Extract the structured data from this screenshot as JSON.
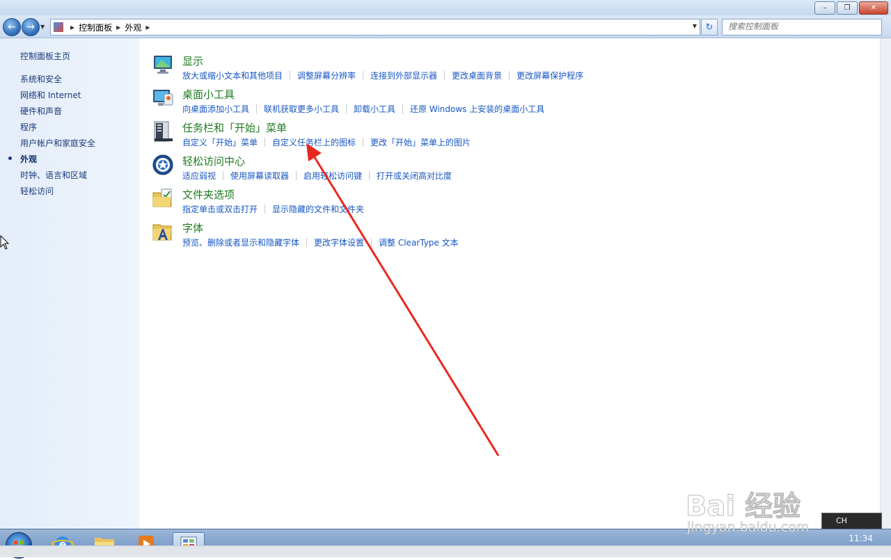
{
  "window": {
    "minimize": "–",
    "maximize": "❐",
    "close": "✕"
  },
  "navbar": {
    "back_icon": "arrow-left-icon",
    "forward_icon": "arrow-right-icon",
    "breadcrumbs": [
      "控制面板",
      "外观"
    ],
    "refresh_icon": "refresh-icon",
    "search_placeholder": "搜索控制面板"
  },
  "sidebar": {
    "items": [
      {
        "label": "控制面板主页",
        "current": false
      },
      {
        "label": "系统和安全",
        "current": false
      },
      {
        "label": "网络和 Internet",
        "current": false
      },
      {
        "label": "硬件和声音",
        "current": false
      },
      {
        "label": "程序",
        "current": false
      },
      {
        "label": "用户帐户和家庭安全",
        "current": false
      },
      {
        "label": "外观",
        "current": true
      },
      {
        "label": "时钟、语言和区域",
        "current": false
      },
      {
        "label": "轻松访问",
        "current": false
      }
    ]
  },
  "categories": [
    {
      "title": "显示",
      "icon": "display-icon",
      "links": [
        "放大或缩小文本和其他项目",
        "调整屏幕分辨率",
        "连接到外部显示器",
        "更改桌面背景",
        "更改屏幕保护程序"
      ]
    },
    {
      "title": "桌面小工具",
      "icon": "gadgets-icon",
      "links": [
        "向桌面添加小工具",
        "联机获取更多小工具",
        "卸载小工具",
        "还原 Windows 上安装的桌面小工具"
      ]
    },
    {
      "title": "任务栏和「开始」菜单",
      "icon": "taskbar-icon",
      "links": [
        "自定义「开始」菜单",
        "自定义任务栏上的图标",
        "更改「开始」菜单上的图片"
      ]
    },
    {
      "title": "轻松访问中心",
      "icon": "ease-of-access-icon",
      "links": [
        "适应弱视",
        "使用屏幕读取器",
        "启用轻松访问键",
        "打开或关闭高对比度"
      ]
    },
    {
      "title": "文件夹选项",
      "icon": "folder-options-icon",
      "links": [
        "指定单击或双击打开",
        "显示隐藏的文件和文件夹"
      ]
    },
    {
      "title": "字体",
      "icon": "fonts-icon",
      "links": [
        "预览、删除或者显示和隐藏字体",
        "更改字体设置",
        "调整 ClearType 文本"
      ]
    }
  ],
  "taskbar": {
    "clock": "11:34",
    "language": "CH"
  },
  "watermark": {
    "brand": "Bai 经验",
    "url": "jingyan.baidu.com"
  },
  "colors": {
    "link": "#1556c4",
    "category_title": "#1e7a1e",
    "sidebar_bg": "#e4edf9",
    "annotation_arrow": "#e8281e"
  }
}
